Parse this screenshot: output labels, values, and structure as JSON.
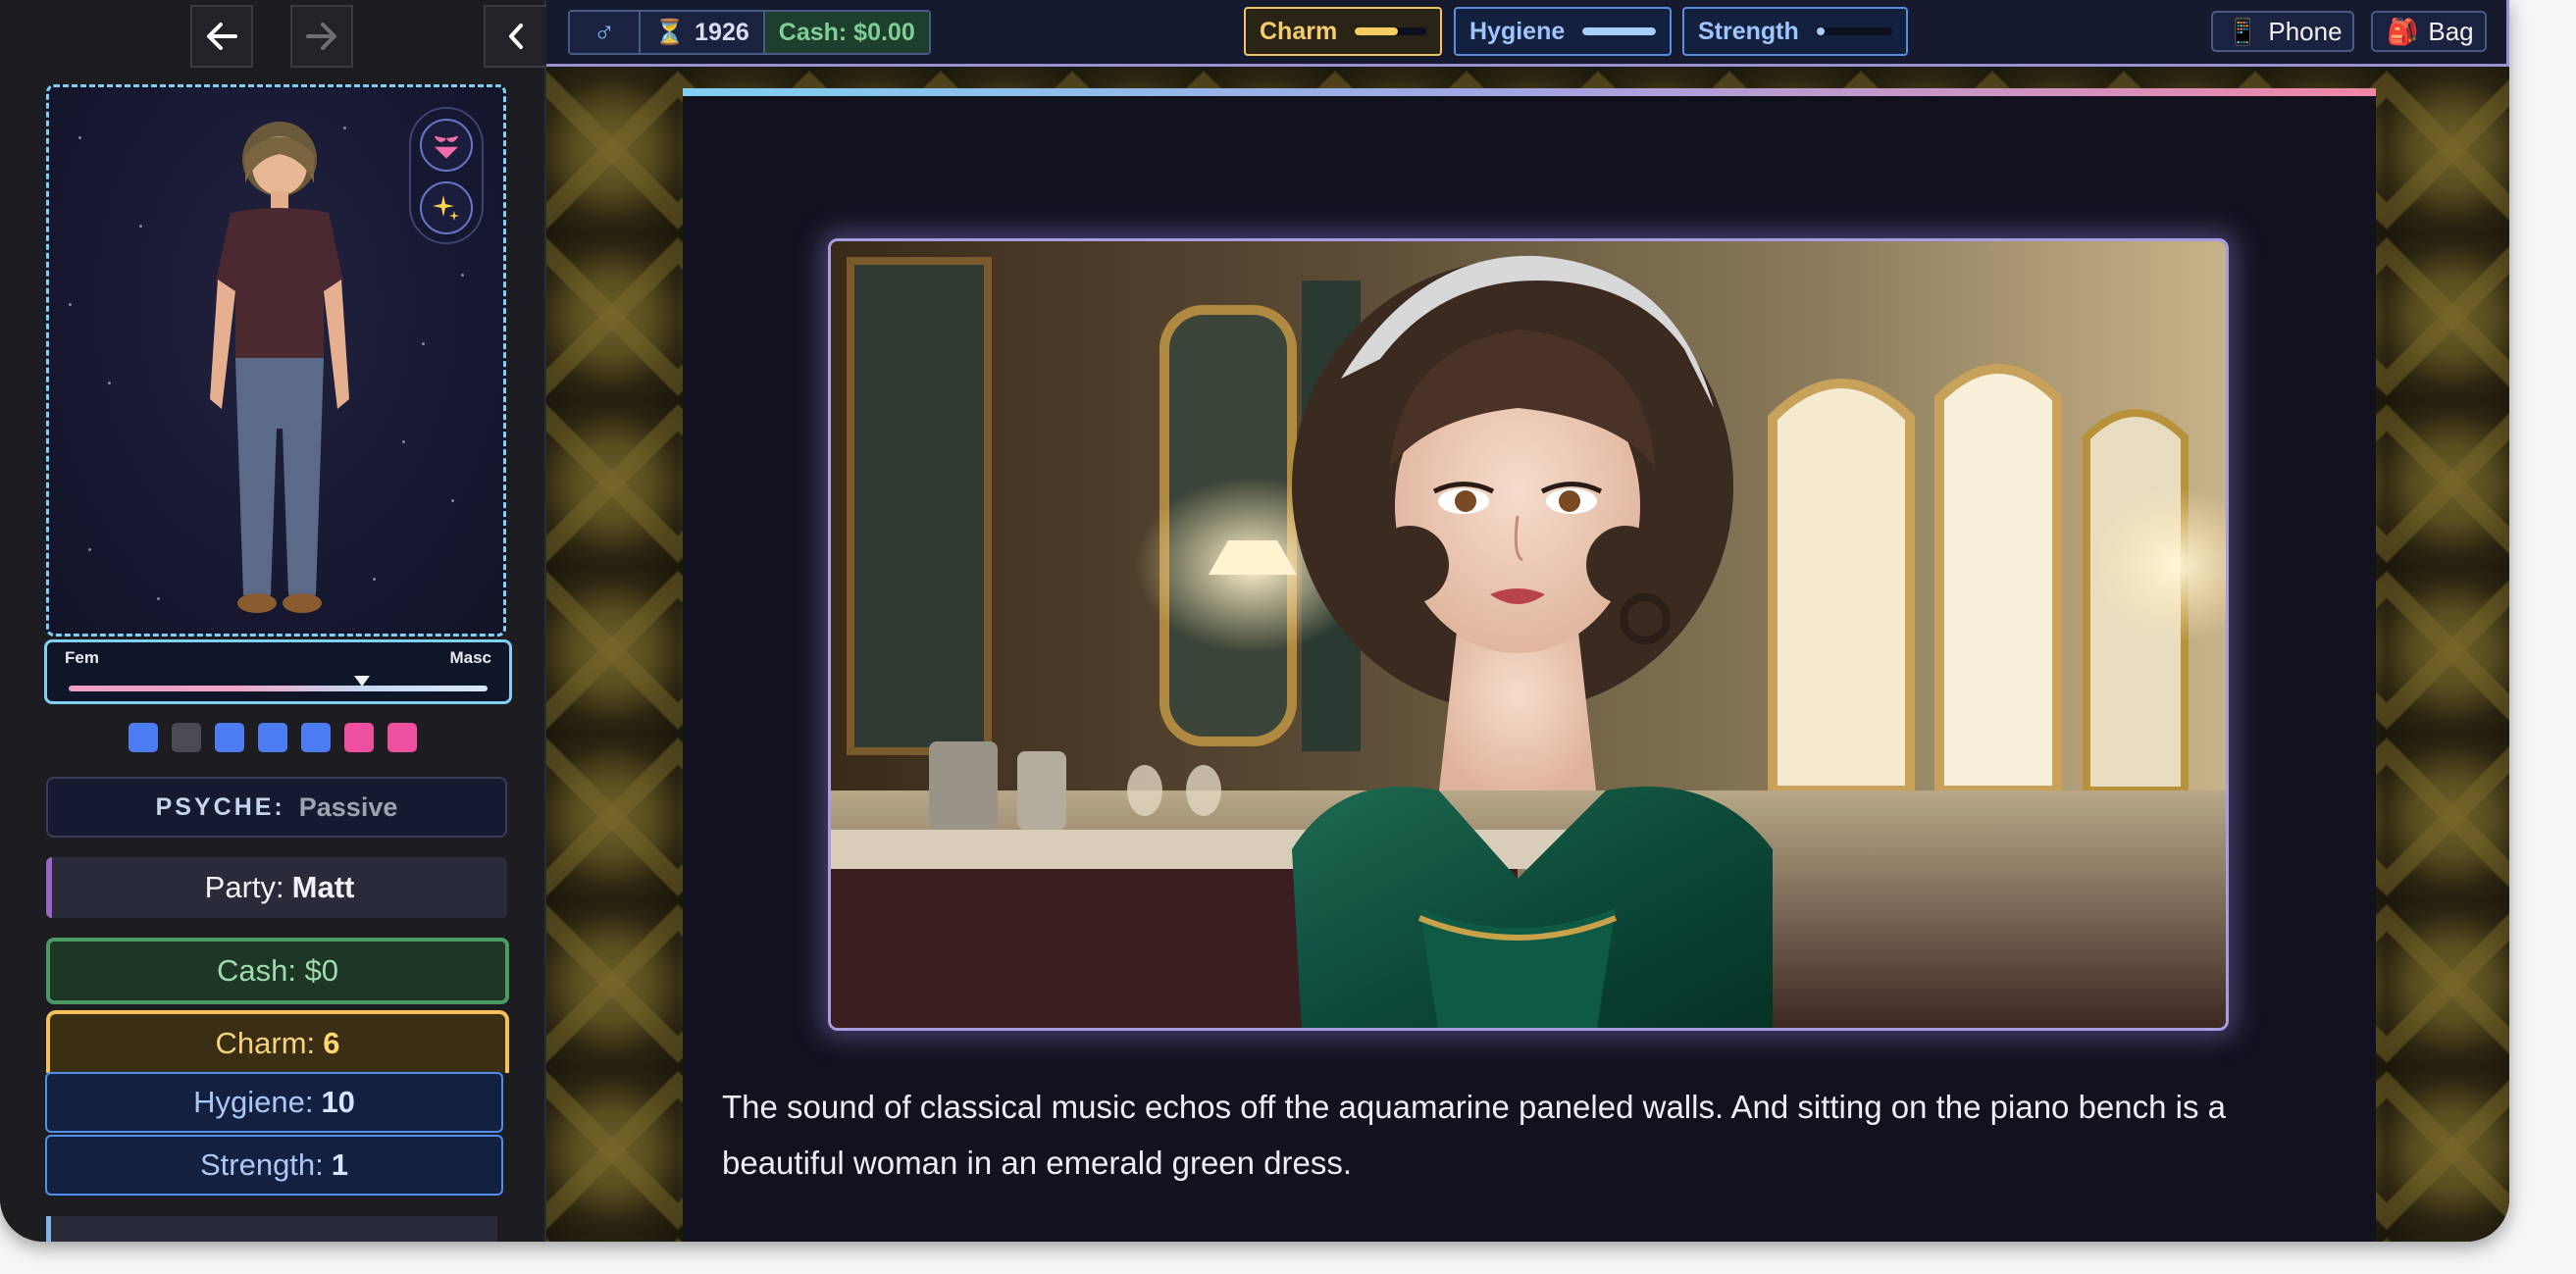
{
  "nav": {
    "back_label": "back",
    "forward_label": "forward",
    "collapse_label": "collapse"
  },
  "avatar": {
    "description_name": "player-avatar"
  },
  "gender_slider": {
    "fem_label": "Fem",
    "masc_label": "Masc",
    "position_fraction": 0.7
  },
  "trait_dots": [
    {
      "color": "#4d7df2"
    },
    {
      "color": "#4a4a52"
    },
    {
      "color": "#4d7df2"
    },
    {
      "color": "#4d7df2"
    },
    {
      "color": "#4d7df2"
    },
    {
      "color": "#ee4f9f"
    },
    {
      "color": "#ee4f9f"
    }
  ],
  "psyche": {
    "label": "PSYCHE:",
    "value": "Passive"
  },
  "party": {
    "label": "Party:",
    "name": "Matt"
  },
  "stats": {
    "cash": {
      "label": "Cash:",
      "value": "$0"
    },
    "charm": {
      "label": "Charm:",
      "value": "6"
    },
    "hygiene": {
      "label": "Hygiene:",
      "value": "10"
    },
    "strength": {
      "label": "Strength:",
      "value": "1"
    }
  },
  "topbar": {
    "gender_symbol": "♂",
    "year_icon": "⏳",
    "year": "1926",
    "cash_text": "Cash: $0.00",
    "charm": {
      "label": "Charm",
      "level": 0.6
    },
    "hygiene": {
      "label": "Hygiene",
      "level": 1.0
    },
    "strength": {
      "label": "Strength",
      "level": 0.1
    },
    "phone_icon": "📱",
    "phone_label": "Phone",
    "bag_icon": "🎒",
    "bag_label": "Bag"
  },
  "scene": {
    "narration": "The sound of classical music echos off the aquamarine paneled walls. And sitting on the piano bench is a beautiful woman in an emerald green dress."
  },
  "colors": {
    "accent_blue": "#7fd0f3",
    "accent_purple": "#a89de0",
    "charm_gold": "#f6bf57",
    "cash_green": "#4a9a64"
  }
}
